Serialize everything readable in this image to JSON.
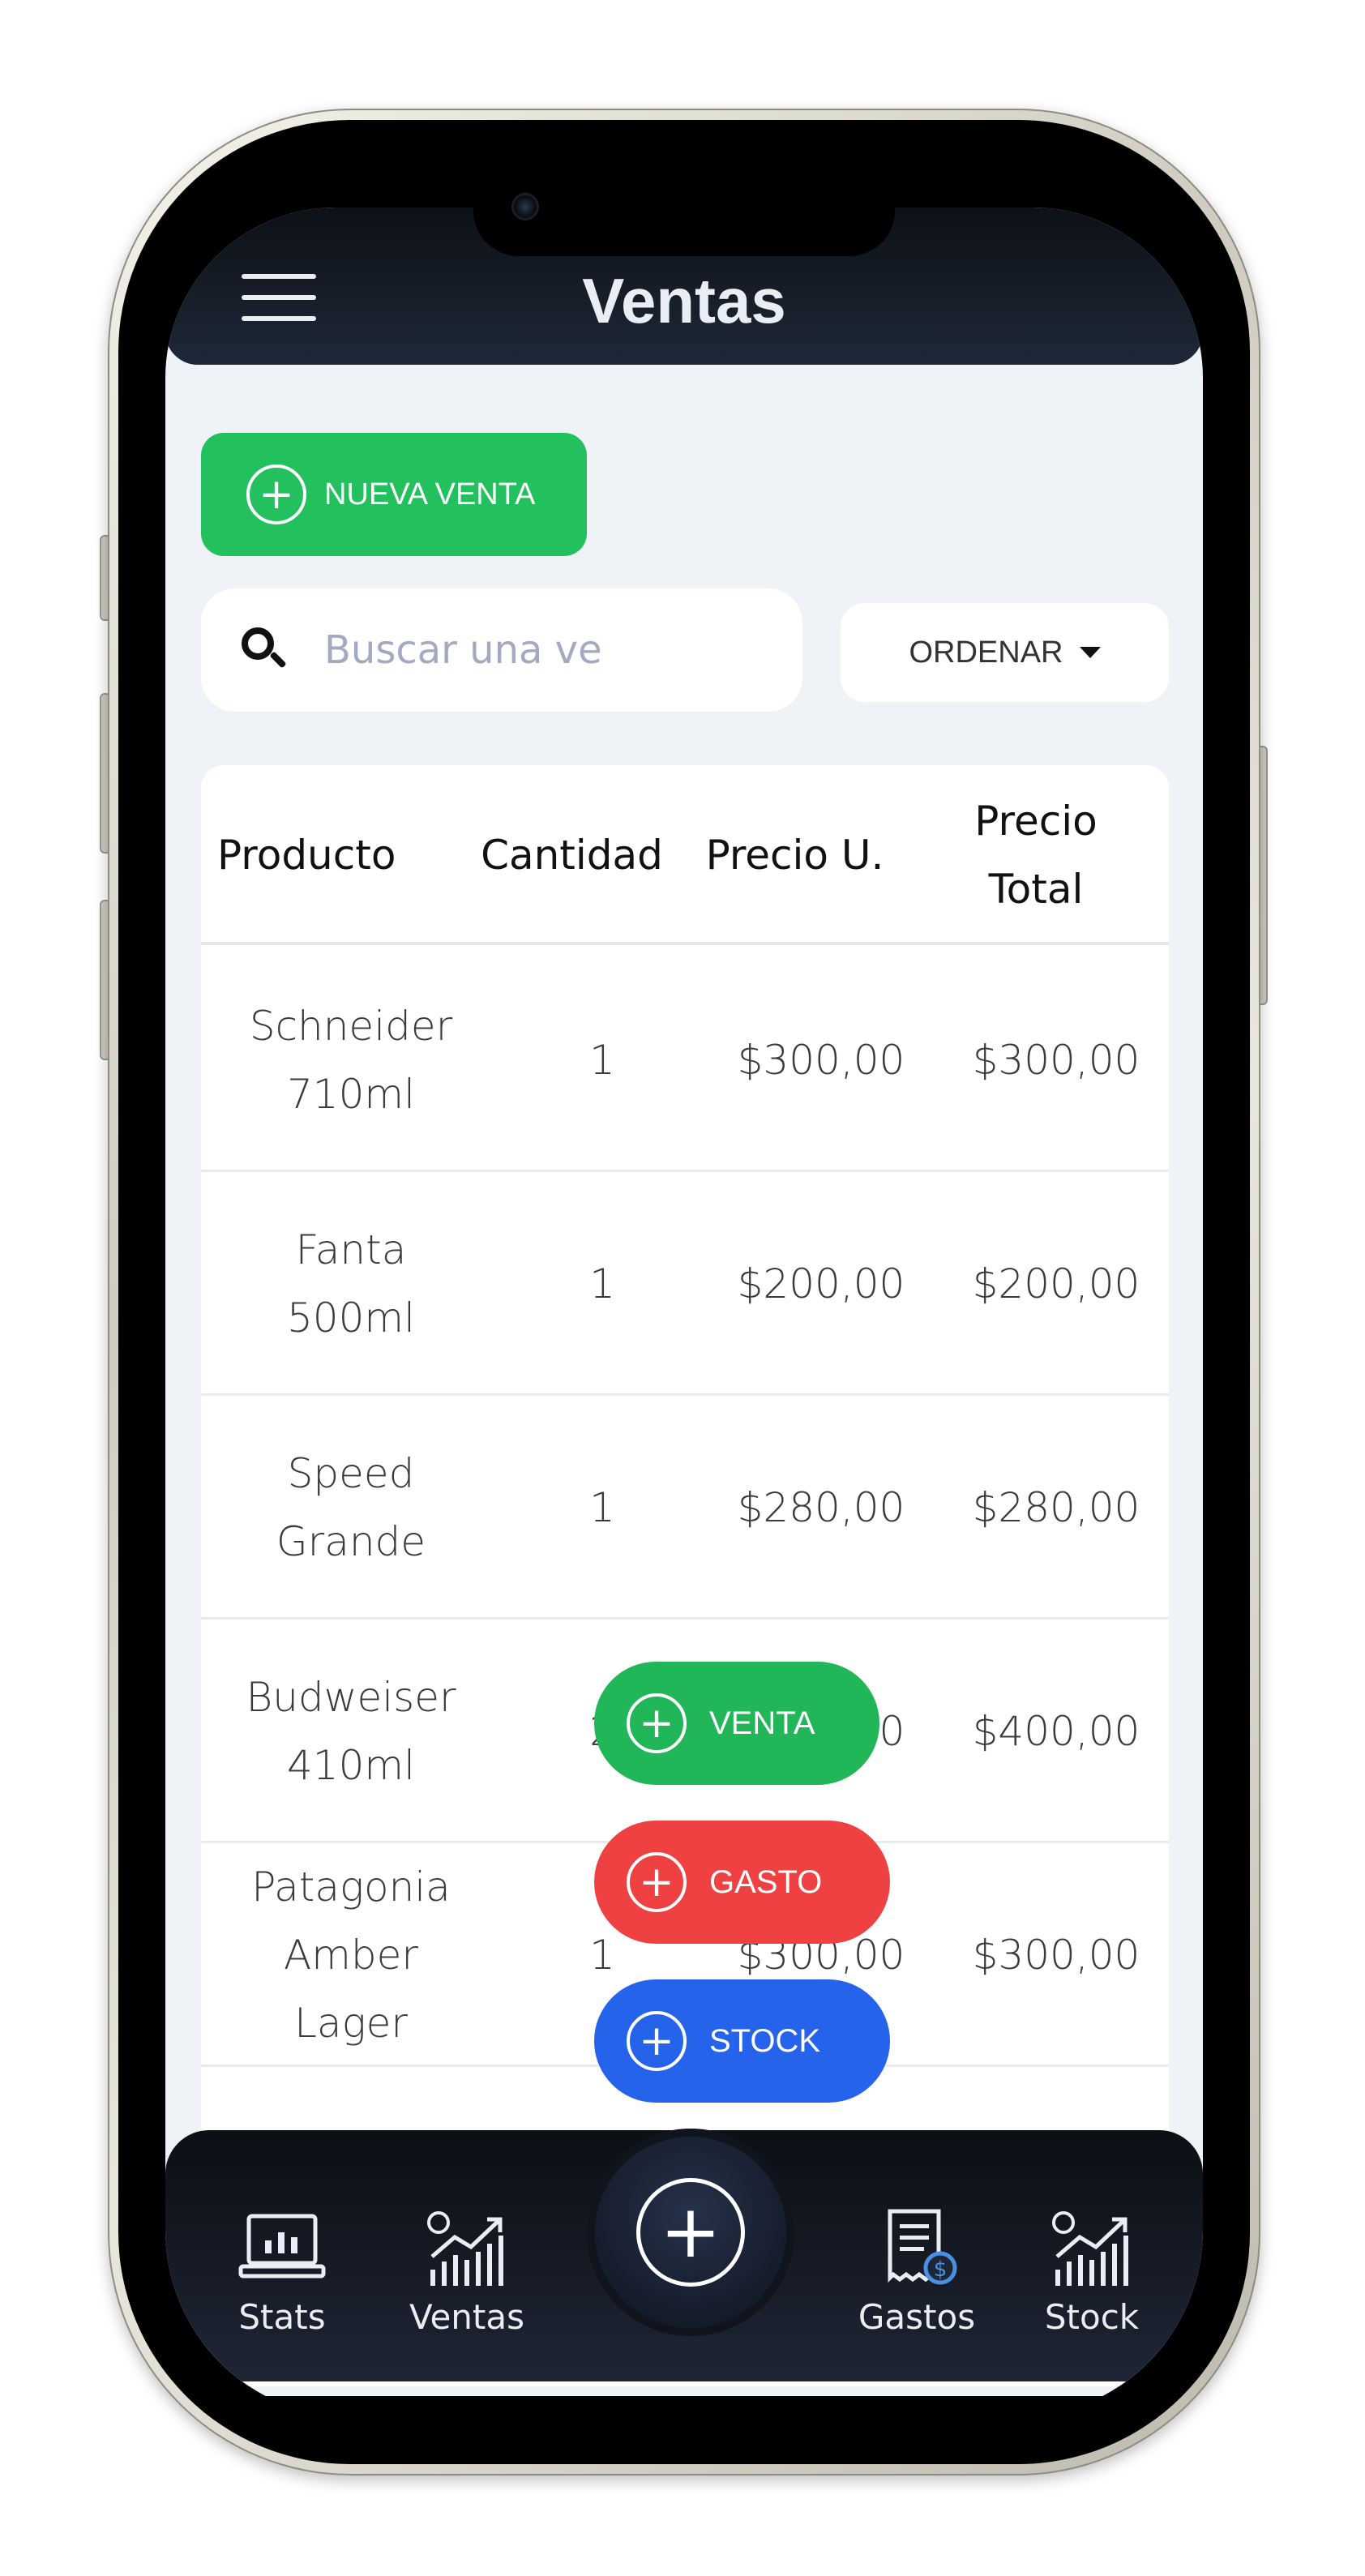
{
  "header": {
    "title": "Ventas",
    "menu_icon": "hamburger-menu-icon"
  },
  "actions": {
    "new_sale_label": "NUEVA VENTA",
    "search_placeholder": "Buscar una ve",
    "sort_label": "ORDENAR"
  },
  "table": {
    "columns": [
      "Producto",
      "Cantidad",
      "Precio U.",
      "Precio\nTotal"
    ],
    "rows": [
      {
        "producto": "Schneider\n710ml",
        "cantidad": "1",
        "precio_u": "$300,00",
        "precio_total": "$300,00"
      },
      {
        "producto": "Fanta\n500ml",
        "cantidad": "1",
        "precio_u": "$200,00",
        "precio_total": "$200,00"
      },
      {
        "producto": "Speed\nGrande",
        "cantidad": "1",
        "precio_u": "$280,00",
        "precio_total": "$280,00"
      },
      {
        "producto": "Budweiser\n410ml",
        "cantidad": "2",
        "precio_u": "$200,00",
        "precio_total": "$400,00"
      },
      {
        "producto": "Patagonia\nAmber\nLager",
        "cantidad": "1",
        "precio_u": "$300,00",
        "precio_total": "$300,00"
      }
    ]
  },
  "quick_actions": {
    "venta_label": "VENTA",
    "gasto_label": "GASTO",
    "stock_label": "STOCK"
  },
  "bottom_nav": {
    "stats": "Stats",
    "ventas": "Ventas",
    "gastos": "Gastos",
    "stock": "Stock"
  },
  "colors": {
    "green": "#22c15e",
    "red": "#ef4141",
    "blue": "#2563eb",
    "header_dark": "#0d1117"
  }
}
